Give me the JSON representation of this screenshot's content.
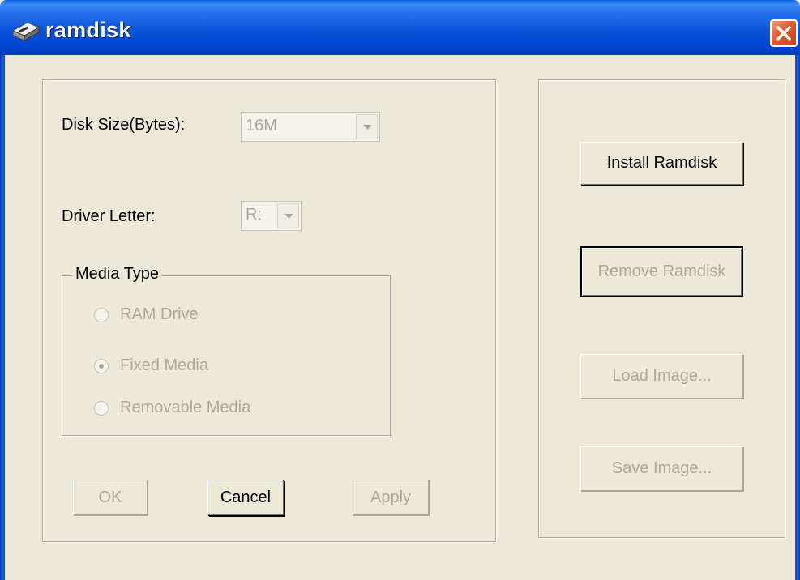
{
  "window": {
    "title": "ramdisk"
  },
  "settings": {
    "disk_size_label": "Disk Size(Bytes):",
    "disk_size_value": "16M",
    "drive_letter_label": "Driver Letter:",
    "drive_letter_value": "R:"
  },
  "media_type": {
    "legend": "Media Type",
    "options": [
      {
        "label": "RAM Drive",
        "selected": false
      },
      {
        "label": "Fixed Media",
        "selected": true
      },
      {
        "label": "Removable Media",
        "selected": false
      }
    ]
  },
  "dialog_buttons": {
    "ok": "OK",
    "cancel": "Cancel",
    "apply": "Apply"
  },
  "actions": {
    "install": "Install Ramdisk",
    "remove": "Remove Ramdisk",
    "load": "Load Image...",
    "save": "Save Image..."
  },
  "icons": {
    "app": "disk-icon",
    "close": "close-icon",
    "dropdown": "chevron-down-icon"
  }
}
